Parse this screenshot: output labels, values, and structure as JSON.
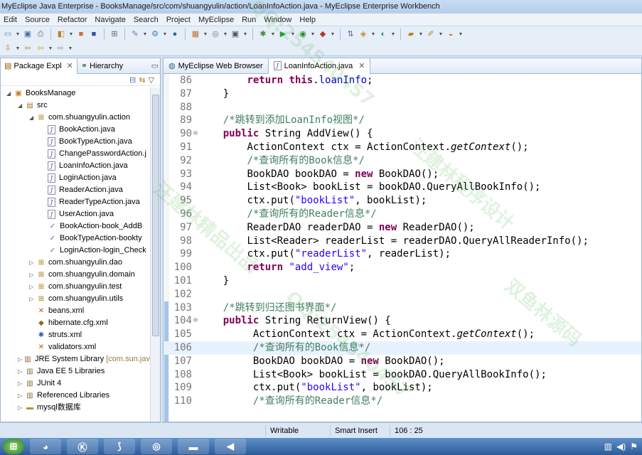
{
  "window": {
    "title": "MyEclipse Java Enterprise - BooksManage/src/com/shuangyulin/action/LoanInfoAction.java - MyEclipse Enterprise Workbench"
  },
  "menu": [
    "Edit",
    "Source",
    "Refactor",
    "Navigate",
    "Search",
    "Project",
    "MyEclipse",
    "Run",
    "Window",
    "Help"
  ],
  "toolbar1": [
    "new-icon",
    "save-icon",
    "print-icon",
    "new-wizard-icon",
    "open-type-icon",
    "deploy-icon",
    "browser-icon",
    "open-perspective-icon",
    "run-server-icon",
    "globe-icon",
    "new-class-icon",
    "new-package-icon",
    "new-interface-icon",
    "debug-icon",
    "run-icon",
    "run-config-icon",
    "external-tools-icon",
    "coverage-icon",
    "open-folder-icon",
    "pencil-icon",
    "open-task-icon"
  ],
  "toolbar2": [
    "back-icon",
    "forward-icon",
    "last-edit-icon",
    "nav-back-icon",
    "nav-forward-icon"
  ],
  "left_panel": {
    "tabs": [
      {
        "label": "Package Expl",
        "icon": "package-explorer-icon"
      },
      {
        "label": "Hierarchy",
        "icon": "hierarchy-icon"
      }
    ],
    "tree": [
      {
        "label": "BooksManage",
        "depth": 1,
        "icon": "project-icon",
        "twisty": "open"
      },
      {
        "label": "src",
        "depth": 2,
        "icon": "source-folder-icon",
        "twisty": "open"
      },
      {
        "label": "com.shuangyulin.action",
        "depth": 3,
        "icon": "package-icon",
        "twisty": "open"
      },
      {
        "label": "BookAction.java",
        "depth": 4,
        "icon": "java-file-icon"
      },
      {
        "label": "BookTypeAction.java",
        "depth": 4,
        "icon": "java-file-icon"
      },
      {
        "label": "ChangePasswordAction.j",
        "depth": 4,
        "icon": "java-file-icon"
      },
      {
        "label": "LoanInfoAction.java",
        "depth": 4,
        "icon": "java-file-icon"
      },
      {
        "label": "LoginAction.java",
        "depth": 4,
        "icon": "java-file-icon"
      },
      {
        "label": "ReaderAction.java",
        "depth": 4,
        "icon": "java-file-icon"
      },
      {
        "label": "ReaderTypeAction.java",
        "depth": 4,
        "icon": "java-file-icon"
      },
      {
        "label": "UserAction.java",
        "depth": 4,
        "icon": "java-file-icon"
      },
      {
        "label": "BookAction-book_AddB",
        "depth": 4,
        "icon": "validation-xml-icon"
      },
      {
        "label": "BookTypeAction-bookty",
        "depth": 4,
        "icon": "validation-xml-icon"
      },
      {
        "label": "LoginAction-login_Check",
        "depth": 4,
        "icon": "validation-xml-icon"
      },
      {
        "label": "com.shuangyulin.dao",
        "depth": 3,
        "icon": "package-icon",
        "twisty": "closed"
      },
      {
        "label": "com.shuangyulin.domain",
        "depth": 3,
        "icon": "package-icon",
        "twisty": "closed"
      },
      {
        "label": "com.shuangyulin.test",
        "depth": 3,
        "icon": "package-icon",
        "twisty": "closed"
      },
      {
        "label": "com.shuangyulin.utils",
        "depth": 3,
        "icon": "package-icon",
        "twisty": "closed"
      },
      {
        "label": "beans.xml",
        "depth": 3,
        "icon": "xml-file-icon"
      },
      {
        "label": "hibernate.cfg.xml",
        "depth": 3,
        "icon": "hibernate-config-icon"
      },
      {
        "label": "struts.xml",
        "depth": 3,
        "icon": "struts-config-icon"
      },
      {
        "label": "validators.xml",
        "depth": 3,
        "icon": "xml-file-icon"
      },
      {
        "label": "JRE System Library [com.sun.jav",
        "depth": 2,
        "icon": "library-icon",
        "twisty": "closed"
      },
      {
        "label": "Java EE 5 Libraries",
        "depth": 2,
        "icon": "library-icon",
        "twisty": "closed"
      },
      {
        "label": "JUnit 4",
        "depth": 2,
        "icon": "library-icon",
        "twisty": "closed"
      },
      {
        "label": "Referenced Libraries",
        "depth": 2,
        "icon": "library-icon",
        "twisty": "closed"
      },
      {
        "label": "mysql数据库",
        "depth": 2,
        "icon": "folder-icon",
        "twisty": "closed"
      }
    ]
  },
  "editor": {
    "tabs": [
      {
        "label": "MyEclipse Web Browser",
        "icon": "web-browser-icon",
        "active": false
      },
      {
        "label": "LoanInfoAction.java",
        "icon": "java-file-icon",
        "active": true
      }
    ],
    "highlight_line": 106,
    "lines": [
      {
        "n": "86",
        "fold": "",
        "indent": "        ",
        "tokens": [
          [
            "kw",
            "return "
          ],
          [
            "kw",
            "this"
          ],
          [
            "tx",
            "."
          ],
          [
            "fld",
            "loanInfo"
          ],
          [
            "tx",
            ";"
          ]
        ]
      },
      {
        "n": "87",
        "fold": "",
        "indent": "    ",
        "tokens": [
          [
            "tx",
            "}"
          ]
        ]
      },
      {
        "n": "88",
        "fold": "",
        "indent": "",
        "tokens": []
      },
      {
        "n": "89",
        "fold": "",
        "indent": "    ",
        "tokens": [
          [
            "cmt",
            "/*跳转到添加LoanInfo视图*/"
          ]
        ]
      },
      {
        "n": "90",
        "fold": "⊖",
        "indent": "    ",
        "tokens": [
          [
            "kw",
            "public "
          ],
          [
            "tx",
            "String AddView() {"
          ]
        ]
      },
      {
        "n": "91",
        "fold": "",
        "indent": "        ",
        "tokens": [
          [
            "tx",
            "ActionContext ctx = ActionContext."
          ],
          [
            "it",
            "getContext"
          ],
          [
            "tx",
            "();"
          ]
        ]
      },
      {
        "n": "92",
        "fold": "",
        "indent": "        ",
        "tokens": [
          [
            "cmt",
            "/*查询所有的Book信息*/"
          ]
        ]
      },
      {
        "n": "93",
        "fold": "",
        "indent": "        ",
        "tokens": [
          [
            "tx",
            "BookDAO bookDAO = "
          ],
          [
            "kw",
            "new "
          ],
          [
            "tx",
            "BookDAO();"
          ]
        ]
      },
      {
        "n": "94",
        "fold": "",
        "indent": "        ",
        "tokens": [
          [
            "tx",
            "List<Book> bookList = bookDAO.QueryAllBookInfo();"
          ]
        ]
      },
      {
        "n": "95",
        "fold": "",
        "indent": "        ",
        "tokens": [
          [
            "tx",
            "ctx.put("
          ],
          [
            "str",
            "\"bookList\""
          ],
          [
            "tx",
            ", bookList);"
          ]
        ]
      },
      {
        "n": "96",
        "fold": "",
        "indent": "        ",
        "tokens": [
          [
            "cmt",
            "/*查询所有的Reader信息*/"
          ]
        ]
      },
      {
        "n": "97",
        "fold": "",
        "indent": "        ",
        "tokens": [
          [
            "tx",
            "ReaderDAO readerDAO = "
          ],
          [
            "kw",
            "new "
          ],
          [
            "tx",
            "ReaderDAO();"
          ]
        ]
      },
      {
        "n": "98",
        "fold": "",
        "indent": "        ",
        "tokens": [
          [
            "tx",
            "List<Reader> readerList = readerDAO.QueryAllReaderInfo();"
          ]
        ]
      },
      {
        "n": "99",
        "fold": "",
        "indent": "        ",
        "tokens": [
          [
            "tx",
            "ctx.put("
          ],
          [
            "str",
            "\"readerList\""
          ],
          [
            "tx",
            ", readerList);"
          ]
        ]
      },
      {
        "n": "100",
        "fold": "",
        "indent": "        ",
        "tokens": [
          [
            "kw",
            "return "
          ],
          [
            "str",
            "\"add_view\""
          ],
          [
            "tx",
            ";"
          ]
        ]
      },
      {
        "n": "101",
        "fold": "",
        "indent": "    ",
        "tokens": [
          [
            "tx",
            "}"
          ]
        ]
      },
      {
        "n": "102",
        "fold": "",
        "indent": "",
        "tokens": []
      },
      {
        "n": "103",
        "fold": "",
        "indent": "    ",
        "tokens": [
          [
            "cmt",
            "/*跳转到归还图书界面*/"
          ]
        ]
      },
      {
        "n": "104",
        "fold": "⊖",
        "indent": "    ",
        "tokens": [
          [
            "kw",
            "public "
          ],
          [
            "tx",
            "String ReturnView() {"
          ]
        ]
      },
      {
        "n": "105",
        "fold": "",
        "indent": "         ",
        "tokens": [
          [
            "tx",
            "ActionContext ctx = ActionContext."
          ],
          [
            "it",
            "getContext"
          ],
          [
            "tx",
            "();"
          ]
        ]
      },
      {
        "n": "106",
        "fold": "",
        "indent": "         ",
        "tokens": [
          [
            "cmt",
            "/*查询所有的Book信息*/"
          ]
        ]
      },
      {
        "n": "107",
        "fold": "",
        "indent": "         ",
        "tokens": [
          [
            "tx",
            "BookDAO bookDAO = "
          ],
          [
            "kw",
            "new "
          ],
          [
            "tx",
            "BookDAO();"
          ]
        ]
      },
      {
        "n": "108",
        "fold": "",
        "indent": "         ",
        "tokens": [
          [
            "tx",
            "List<Book> bookList = bookDAO.QueryAllBookInfo();"
          ]
        ]
      },
      {
        "n": "109",
        "fold": "",
        "indent": "         ",
        "tokens": [
          [
            "tx",
            "ctx.put("
          ],
          [
            "str",
            "\"bookList\""
          ],
          [
            "tx",
            ", bookList);"
          ]
        ]
      },
      {
        "n": "110",
        "fold": "",
        "indent": "         ",
        "tokens": [
          [
            "cmt",
            "/*查询所有的Reader信息*/"
          ]
        ]
      }
    ]
  },
  "status": {
    "mode": "Writable",
    "insert": "Smart Insert",
    "position": "106 : 25"
  },
  "taskbar": {
    "items": [
      "start-orb-icon",
      "qq-icon",
      "kugou-icon",
      "myeclipse-icon",
      "browser-360-icon",
      "folder-icon",
      "media-player-icon"
    ],
    "tray": [
      "network-icon",
      "volume-icon",
      "flag-icon"
    ]
  },
  "watermarks": [
    "QQ:254540457",
    "汪建林程序设计",
    "双鱼林源码",
    "汪建林精品出品",
    "QQ:254540457"
  ],
  "colors": {
    "keyword": "#7f0055",
    "string": "#2a00ff",
    "comment": "#3f7f5f",
    "field": "#0000c0",
    "line_highlight": "#e8f2fe"
  }
}
